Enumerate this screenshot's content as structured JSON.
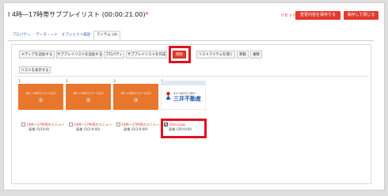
{
  "header": {
    "title": "I 4時―17時帯サブプレイリスト (00:00:21.00)",
    "required_mark": "*",
    "reset": "リセット",
    "save_label": "変更内容を保存する",
    "save_close_label": "保存して閉じる"
  },
  "tabs": [
    {
      "label": "プロパティ"
    },
    {
      "label": "データ・ード"
    },
    {
      "label": "オブジェクト履歴"
    },
    {
      "label": "アイテム (4)",
      "active": true
    }
  ],
  "toolbar": [
    {
      "label": "メディアを追加する"
    },
    {
      "label": "サブプレイリストを追加する"
    },
    {
      "label": "プロパティ"
    },
    {
      "label": "サブプレイリストを作成"
    },
    {
      "label": "削除",
      "highlight": true
    },
    {
      "label": "リストアイテムを開く"
    },
    {
      "label": "移動"
    },
    {
      "label": "複数"
    }
  ],
  "list_button": "リストを表示する",
  "items": [
    {
      "index": "1",
      "slide_text": "4時〜17時帯ポスターを表示",
      "slide_number": "①",
      "checkbox": false,
      "name": "14時〜17時帯のメニュー",
      "duration": "画像 (5/16:9)"
    },
    {
      "index": "2",
      "slide_text": "4時〜17時帯ポスターを表示",
      "slide_number": "②",
      "checkbox": false,
      "name": "14時〜17時帯のメニュー",
      "duration": "画像 (5/2:9:00)"
    },
    {
      "index": "3",
      "slide_text": "4時〜17時帯ポスターを表示",
      "slide_number": "③",
      "checkbox": false,
      "name": "14時〜17時帯のメニュー",
      "duration": "画像 (5/3:9:00)"
    },
    {
      "index": "4",
      "logo_small": "住まいを探すなら国内へ",
      "logo_text": "三井不動産",
      "checkbox": true,
      "name": "mitsui.jpg",
      "duration": "画像 (29:9:00)"
    }
  ],
  "colors": {
    "accent_red": "#e23b2e",
    "highlight": "#e0121e",
    "slide_orange": "#e8772e",
    "logo_blue": "#1e55a8"
  }
}
